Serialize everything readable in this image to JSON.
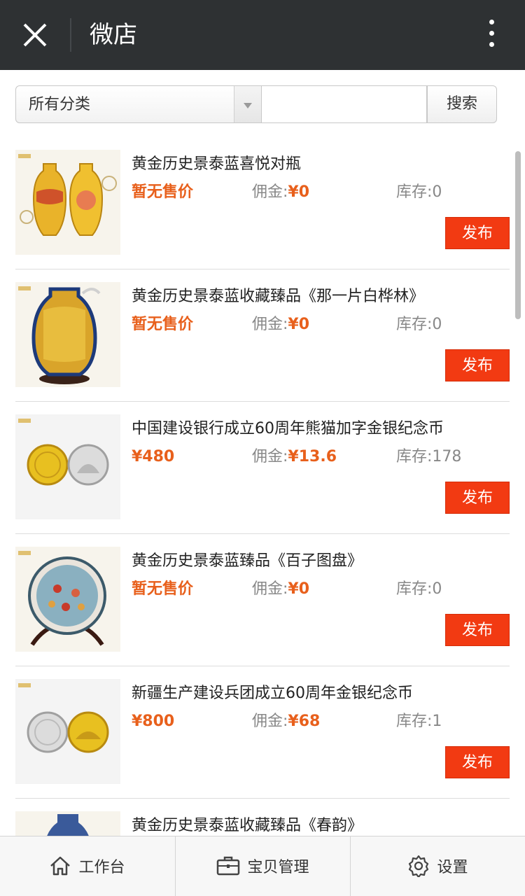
{
  "titlebar": {
    "title": "微店"
  },
  "filter": {
    "category_selected": "所有分类",
    "search_placeholder": "",
    "search_button": "搜索"
  },
  "labels": {
    "commission_prefix": "佣金:",
    "stock_prefix": "库存:",
    "publish": "发布"
  },
  "products": [
    {
      "name": "黄金历史景泰蓝喜悦对瓶",
      "price": "暂无售价",
      "commission": "¥0",
      "stock": "0",
      "thumb_icon": "vase-pair-image"
    },
    {
      "name": "黄金历史景泰蓝收藏臻品《那一片白桦林》",
      "price": "暂无售价",
      "commission": "¥0",
      "stock": "0",
      "thumb_icon": "vase-image"
    },
    {
      "name": "中国建设银行成立60周年熊猫加字金银纪念币",
      "price": "¥480",
      "commission": "¥13.6",
      "stock": "178",
      "thumb_icon": "coins-image"
    },
    {
      "name": "黄金历史景泰蓝臻品《百子图盘》",
      "price": "暂无售价",
      "commission": "¥0",
      "stock": "0",
      "thumb_icon": "plate-image"
    },
    {
      "name": "新疆生产建设兵团成立60周年金银纪念币",
      "price": "¥800",
      "commission": "¥68",
      "stock": "1",
      "thumb_icon": "coins-image"
    },
    {
      "name": "黄金历史景泰蓝收藏臻品《春韵》",
      "price": "",
      "commission": "",
      "stock": "",
      "thumb_icon": "vase-image"
    }
  ],
  "bottom_nav": [
    {
      "label": "工作台",
      "icon": "home-icon"
    },
    {
      "label": "宝贝管理",
      "icon": "briefcase-icon"
    },
    {
      "label": "设置",
      "icon": "gear-icon"
    }
  ],
  "colors": {
    "titlebar_bg": "#2e3133",
    "accent": "#e8601c",
    "publish_bg": "#f23a12"
  }
}
